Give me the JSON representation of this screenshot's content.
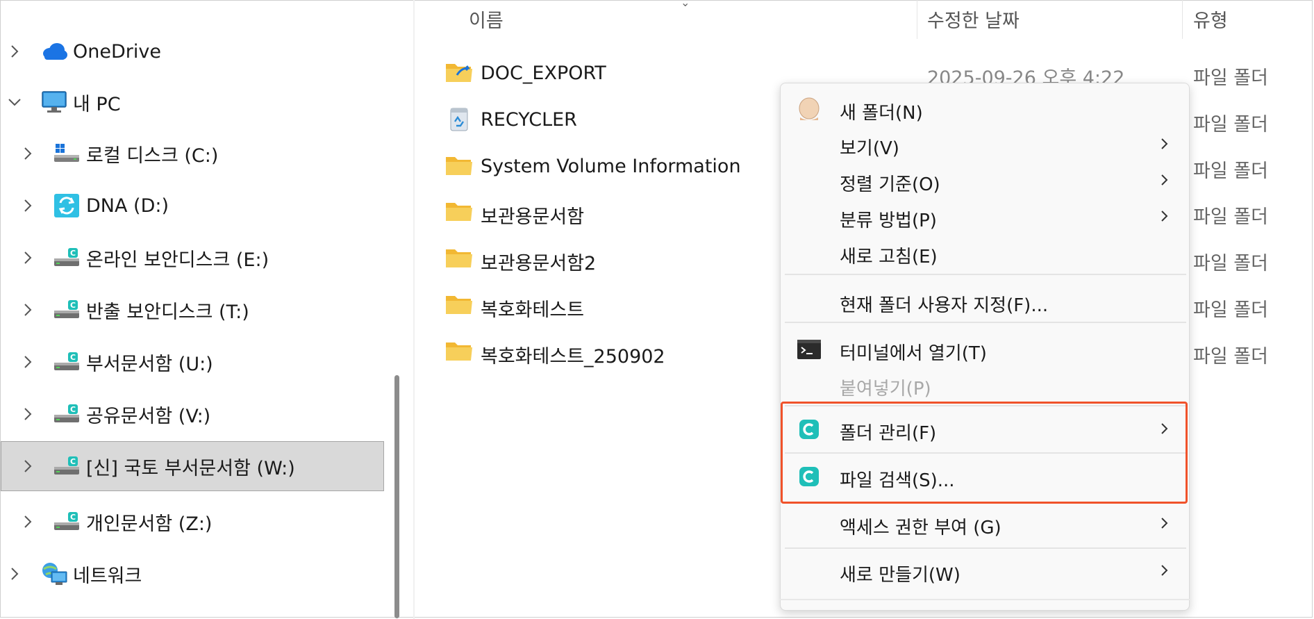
{
  "sidebar": {
    "items": [
      {
        "label": "OneDrive",
        "icon": "onedrive-cloud-icon",
        "expanded": false
      },
      {
        "label": "내 PC",
        "icon": "computer-monitor-icon",
        "expanded": true
      },
      {
        "label": "로컬 디스크 (C:)",
        "icon": "windows-drive-icon",
        "expanded": false
      },
      {
        "label": "DNA (D:)",
        "icon": "sync-drive-icon",
        "expanded": false
      },
      {
        "label": "온라인 보안디스크 (E:)",
        "icon": "secure-drive-icon",
        "expanded": false
      },
      {
        "label": "반출 보안디스크 (T:)",
        "icon": "secure-drive-icon",
        "expanded": false
      },
      {
        "label": "부서문서함 (U:)",
        "icon": "secure-drive-icon",
        "expanded": false
      },
      {
        "label": "공유문서함 (V:)",
        "icon": "secure-drive-icon",
        "expanded": false
      },
      {
        "label": "[신] 국토 부서문서함 (W:)",
        "icon": "secure-drive-icon",
        "expanded": false,
        "selected": true
      },
      {
        "label": "개인문서함 (Z:)",
        "icon": "secure-drive-icon",
        "expanded": false
      },
      {
        "label": "네트워크",
        "icon": "network-globe-icon",
        "expanded": false
      }
    ]
  },
  "columns": {
    "name": "이름",
    "modified": "수정한 날짜",
    "type": "유형"
  },
  "files": [
    {
      "name": "DOC_EXPORT",
      "date": "2025-09-26 오후 4:22",
      "type": "파일 폴더",
      "icon": "shared-folder-icon"
    },
    {
      "name": "RECYCLER",
      "date": "",
      "type": "파일 폴더",
      "icon": "recycle-bin-icon"
    },
    {
      "name": "System Volume Information",
      "date": "",
      "type": "파일 폴더",
      "icon": "folder-icon"
    },
    {
      "name": "보관용문서함",
      "date": "",
      "type": "파일 폴더",
      "icon": "folder-icon"
    },
    {
      "name": "보관용문서함2",
      "date": "",
      "type": "파일 폴더",
      "icon": "folder-icon"
    },
    {
      "name": "복호화테스트",
      "date": "",
      "type": "파일 폴더",
      "icon": "folder-icon"
    },
    {
      "name": "복호화테스트_250902",
      "date": "",
      "type": "파일 폴더",
      "icon": "folder-icon"
    }
  ],
  "context_menu": {
    "items": [
      {
        "label": "새 폴더(N)",
        "icon": "new-folder-icon",
        "submenu": false,
        "disabled": false
      },
      {
        "label": "보기(V)",
        "icon": "",
        "submenu": true,
        "disabled": false
      },
      {
        "label": "정렬 기준(O)",
        "icon": "",
        "submenu": true,
        "disabled": false
      },
      {
        "label": "분류 방법(P)",
        "icon": "",
        "submenu": true,
        "disabled": false
      },
      {
        "label": "새로 고침(E)",
        "icon": "",
        "submenu": false,
        "disabled": false
      },
      {
        "label": "현재 폴더 사용자 지정(F)...",
        "icon": "",
        "submenu": false,
        "disabled": false
      },
      {
        "label": "터미널에서 열기(T)",
        "icon": "terminal-icon",
        "submenu": false,
        "disabled": false
      },
      {
        "label": "붙여넣기(P)",
        "icon": "",
        "submenu": false,
        "disabled": true
      },
      {
        "label": "폴더 관리(F)",
        "icon": "secure-c-icon",
        "submenu": true,
        "disabled": false
      },
      {
        "label": "파일 검색(S)...",
        "icon": "secure-c-icon",
        "submenu": false,
        "disabled": false
      },
      {
        "label": "액세스 권한 부여 (G)",
        "icon": "",
        "submenu": true,
        "disabled": false
      },
      {
        "label": "새로 만들기(W)",
        "icon": "",
        "submenu": true,
        "disabled": false
      }
    ]
  },
  "colors": {
    "selection_bg": "#d9d9d9",
    "highlight_border": "#f0522a",
    "folder_yellow": "#f6c445",
    "secure_teal": "#1fbfb8"
  }
}
